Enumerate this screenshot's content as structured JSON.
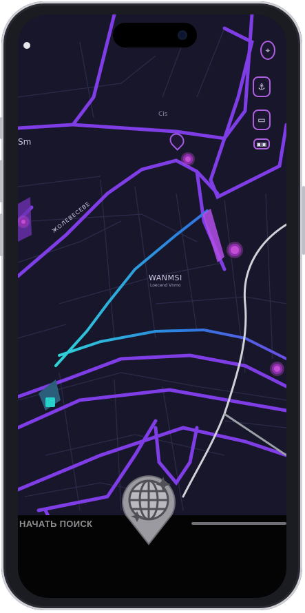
{
  "map": {
    "district_title": "WANMSI",
    "district_subtitle": "Loecend Vnmo",
    "street_label_left": "Sm",
    "street_label_diag": "ЖОЛЕВЕСЕВЕ",
    "poi_label": "Cis",
    "route_gradient": [
      "#2fd4d6",
      "#2b7de0",
      "#6b4ee6"
    ],
    "road_color": "#8a3ff0",
    "transit_line_color": "#cfd2d6"
  },
  "side_controls": [
    {
      "icon": "location-pin-icon"
    },
    {
      "icon": "anchor-icon"
    },
    {
      "icon": "bus-icon"
    },
    {
      "icon": "layers-icon"
    }
  ],
  "bottom": {
    "start_search_label": "НАЧАТЬ ПОИСК",
    "start_search_icon": "globe-pin-icon"
  }
}
